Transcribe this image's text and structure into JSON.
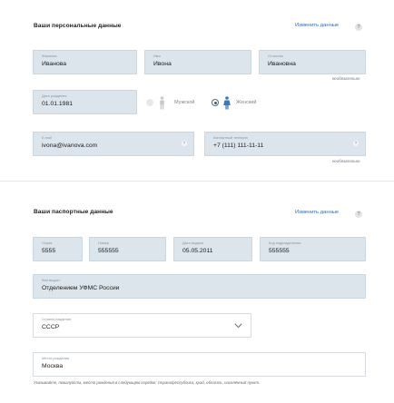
{
  "personal": {
    "title": "Ваши персональные данные",
    "edit_link": "Изменить данные",
    "help": "?",
    "fields": {
      "lastname": {
        "label": "Фамилия",
        "value": "Иванова"
      },
      "firstname": {
        "label": "Имя",
        "value": "Ивона"
      },
      "middlename": {
        "label": "Отчество",
        "value": "Ивановна"
      },
      "optional_note": "необязательно",
      "birthdate": {
        "label": "Дата рождения",
        "value": "01.01.1981"
      },
      "gender": {
        "male": "Мужской",
        "female": "Женский",
        "selected": "female"
      },
      "email": {
        "label": "E-mail",
        "value": "ivona@ivanova.com"
      },
      "phone": {
        "label": "Контактный телефон",
        "value": "+7 (111) 111-11-11"
      },
      "phone_optional_note": "необязательно"
    }
  },
  "passport": {
    "title": "Ваши паспортные данные",
    "edit_link": "Изменить данные",
    "help": "?",
    "fields": {
      "series": {
        "label": "Серия",
        "value": "5555"
      },
      "number": {
        "label": "Номер",
        "value": "555555"
      },
      "issue_date": {
        "label": "Дата выдачи",
        "value": "05.05.2011"
      },
      "division_code": {
        "label": "Код подразделения",
        "value": "555555"
      },
      "issued_by": {
        "label": "Кем выдан",
        "value": "Отделением УФМС России"
      },
      "birth_country": {
        "label": "Страна рождения",
        "value": "СССР"
      },
      "birth_place": {
        "label": "Место рождения",
        "value": "Москва"
      }
    },
    "note": "Указывайте, пожалуйста, место рождения в следующем порядке: страна/республика, край, область, населённый пункт."
  },
  "colors": {
    "field_bg": "#dbe5eb",
    "link": "#2e6ab1",
    "divider": "#e6e9ec"
  }
}
